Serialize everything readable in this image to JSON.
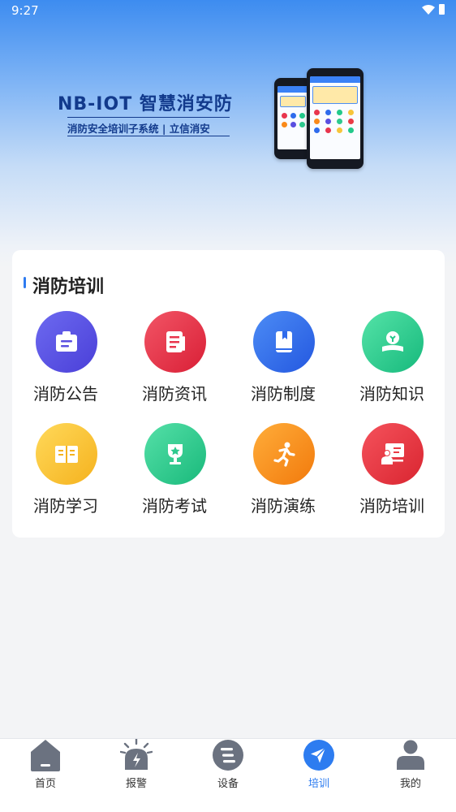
{
  "status_bar": {
    "time": "9:27"
  },
  "banner": {
    "title": "NB-IOT 智慧消安防",
    "subtitle": "消防安全培训子系统 | 立信消安"
  },
  "section": {
    "title": "消防培训",
    "items": [
      {
        "label": "消防公告",
        "icon": "notice-icon",
        "color": "#5a4fe0"
      },
      {
        "label": "消防资讯",
        "icon": "news-icon",
        "color": "#e8354d"
      },
      {
        "label": "消防制度",
        "icon": "book-icon",
        "color": "#2f6bec"
      },
      {
        "label": "消防知识",
        "icon": "knowledge-icon",
        "color": "#22c98a"
      },
      {
        "label": "消防学习",
        "icon": "study-icon",
        "color": "#f7c53b"
      },
      {
        "label": "消防考试",
        "icon": "trophy-icon",
        "color": "#2ec98e"
      },
      {
        "label": "消防演练",
        "icon": "running-icon",
        "color": "#fa8a1a"
      },
      {
        "label": "消防培训",
        "icon": "training-icon",
        "color": "#ea3b45"
      }
    ]
  },
  "tabbar": {
    "active": "培训",
    "items": [
      {
        "label": "首页",
        "icon": "home-icon"
      },
      {
        "label": "报警",
        "icon": "alarm-icon"
      },
      {
        "label": "设备",
        "icon": "device-icon"
      },
      {
        "label": "培训",
        "icon": "send-icon"
      },
      {
        "label": "我的",
        "icon": "user-icon"
      }
    ]
  },
  "colors": {
    "accent": "#2d7cf0",
    "tab_inactive": "#6b7280"
  }
}
